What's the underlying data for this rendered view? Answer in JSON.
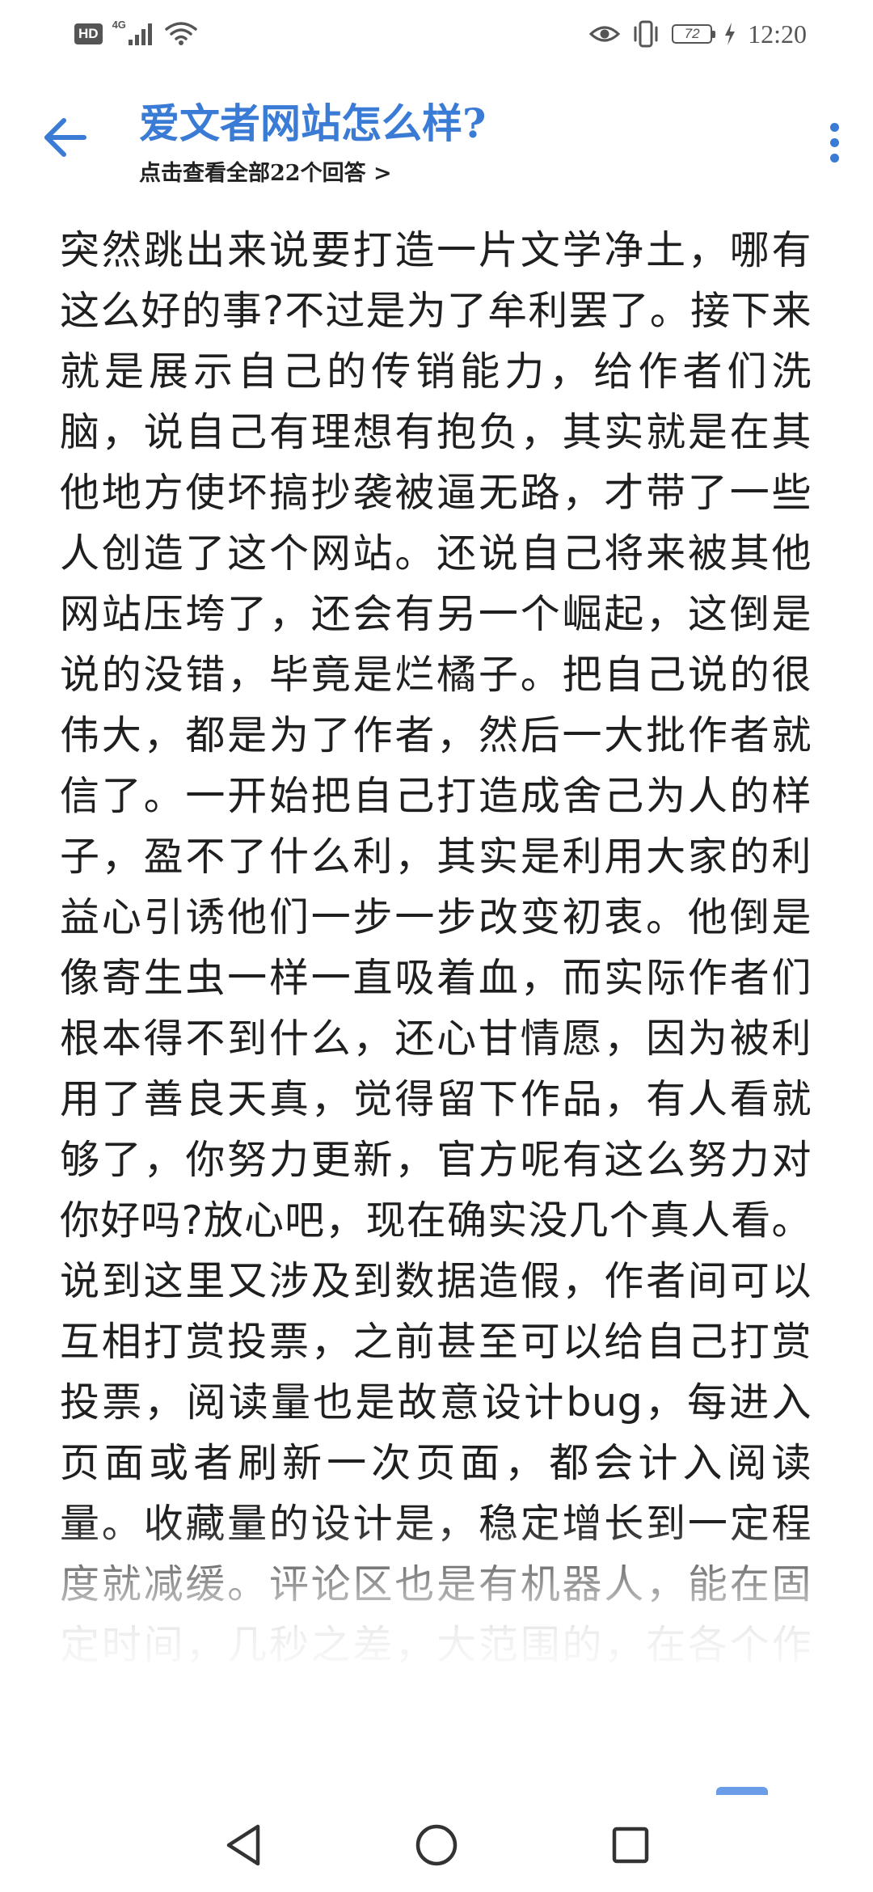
{
  "status_bar": {
    "hd_label": "HD",
    "network_label": "4G",
    "battery_level": "72",
    "time": "12:20",
    "icons": [
      "signal-icon",
      "wifi-icon",
      "eye-icon",
      "vibrate-icon",
      "battery-icon",
      "charging-bolt-icon"
    ]
  },
  "header": {
    "back_icon": "arrow-left-icon",
    "title": "爱文者网站怎么样?",
    "answers_link": "点击查看全部22个回答 >",
    "more_icon": "more-vertical-icon"
  },
  "article": {
    "body": "突然跳出来说要打造一片文学净土，哪有这么好的事?不过是为了牟利罢了。接下来就是展示自己的传销能力，给作者们洗脑，说自己有理想有抱负，其实就是在其他地方使坏搞抄袭被逼无路，才带了一些人创造了这个网站。还说自己将来被其他网站压垮了，还会有另一个崛起，这倒是说的没错，毕竟是烂橘子。把自己说的很伟大，都是为了作者，然后一大批作者就信了。一开始把自己打造成舍己为人的样子，盈不了什么利，其实是利用大家的利益心引诱他们一步一步改变初衷。他倒是像寄生虫一样一直吸着血，而实际作者们根本得不到什么，还心甘情愿，因为被利用了善良天真，觉得留下作品，有人看就够了，你努力更新，官方呢有这么努力对你好吗?放心吧，现在确实没几个真人看。说到这里又涉及到数据造假，作者间可以互相打赏投票，之前甚至可以给自己打赏投票，阅读量也是故意设计bug，每进入页面或者刷新一次页面，都会计入阅读量。收藏量的设计是，稳定增长到一定程度就减缓。评论区也是有机器人，能在固定时间，几秒之差，大范围的，在各个作品下评论相同几个字。评论打赏也是个bug，之前是到不了账的，后来设计为部分到账。这些都是为了打造一个看似有人气的排面"
  },
  "nav_bar": {
    "icons": [
      "nav-back-icon",
      "nav-home-icon",
      "nav-recents-icon"
    ]
  },
  "colors": {
    "accent": "#3a7bd5",
    "text": "#1f1f1f",
    "status": "#555555",
    "background": "#ffffff"
  }
}
